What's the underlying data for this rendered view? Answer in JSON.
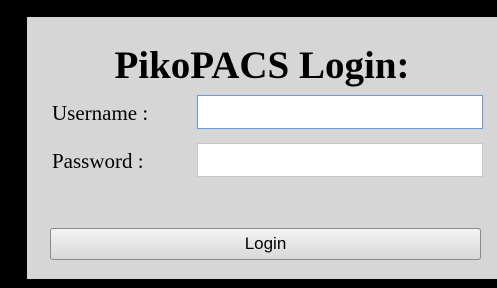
{
  "login": {
    "title": "PikoPACS Login:",
    "username_label": "Username :",
    "username_value": "",
    "password_label": "Password :",
    "password_value": "",
    "button_label": "Login"
  },
  "colors": {
    "page_background": "#000000",
    "panel_background": "#d6d6d6",
    "focus_border": "#6f9fd8"
  }
}
